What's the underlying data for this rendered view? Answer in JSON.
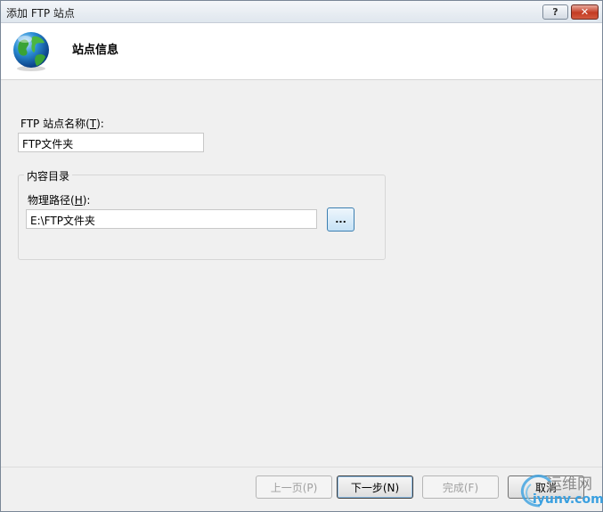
{
  "window": {
    "title": "添加 FTP 站点",
    "help_glyph": "?",
    "close_glyph": "✕"
  },
  "header": {
    "title": "站点信息",
    "icon": "globe-icon"
  },
  "site_name": {
    "label_pre": "FTP 站点名称(",
    "label_key": "T",
    "label_post": "):",
    "value": "FTP文件夹"
  },
  "content_dir": {
    "group_title": "内容目录",
    "path_label_pre": "物理路径(",
    "path_label_key": "H",
    "path_label_post": "):",
    "path_value": "E:\\FTP文件夹",
    "browse_label": "..."
  },
  "buttons": {
    "prev": "上一页(P)",
    "next": "下一步(N)",
    "finish": "完成(F)",
    "cancel": "取消"
  },
  "watermark": {
    "line1": "运维网",
    "line2": "iyunv.com"
  },
  "colors": {
    "accent": "#3c7fb1",
    "close_red": "#c43b22",
    "watermark_blue": "#3aa0e0"
  }
}
